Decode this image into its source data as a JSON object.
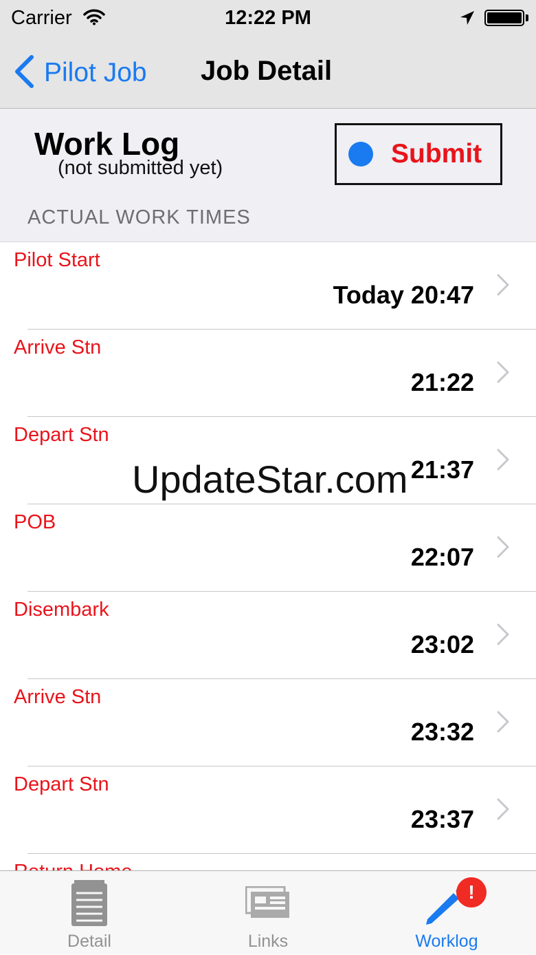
{
  "status_bar": {
    "carrier": "Carrier",
    "time": "12:22 PM"
  },
  "nav": {
    "back_label": "Pilot Job",
    "title": "Job Detail"
  },
  "worklog": {
    "title": "Work Log",
    "subtitle": "(not submitted yet)",
    "submit_label": "Submit",
    "section_header": "ACTUAL WORK TIMES"
  },
  "rows": [
    {
      "label": "Pilot Start",
      "value": "Today 20:47"
    },
    {
      "label": "Arrive Stn",
      "value": "21:22"
    },
    {
      "label": "Depart Stn",
      "value": "21:37"
    },
    {
      "label": "POB",
      "value": "22:07"
    },
    {
      "label": "Disembark",
      "value": "23:02"
    },
    {
      "label": "Arrive Stn",
      "value": "23:32"
    },
    {
      "label": "Depart Stn",
      "value": "23:37"
    },
    {
      "label": "Return Home",
      "value": ""
    }
  ],
  "watermark": "UpdateStar.com",
  "tabs": [
    {
      "label": "Detail",
      "icon": "document-icon",
      "active": false
    },
    {
      "label": "Links",
      "icon": "links-icon",
      "active": false
    },
    {
      "label": "Worklog",
      "icon": "pencil-icon",
      "active": true,
      "badge": "!"
    }
  ],
  "colors": {
    "accent": "#1a7af0",
    "label_red": "#e8141b",
    "badge_red": "#f02b24"
  }
}
